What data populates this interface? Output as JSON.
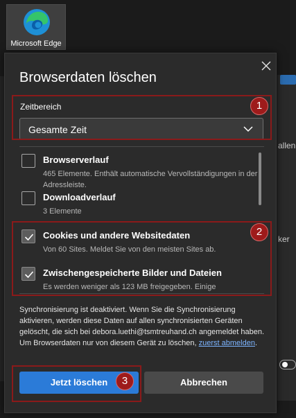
{
  "desktop": {
    "icon_label": "Microsoft Edge",
    "icon": "edge-logo-icon"
  },
  "background": {
    "right_text_1": "allen",
    "right_text_2": "ker"
  },
  "dialog": {
    "title": "Browserdaten löschen",
    "close_icon": "close-icon",
    "time_range": {
      "label": "Zeitbereich",
      "value": "Gesamte Zeit"
    },
    "items": [
      {
        "name": "Browserverlauf",
        "desc": "465 Elemente. Enthält automatische Vervollständigungen in der Adressleiste.",
        "checked": false
      },
      {
        "name": "Downloadverlauf",
        "desc": "3 Elemente",
        "checked": false
      },
      {
        "name": "Cookies und andere Websitedaten",
        "desc": "Von 60 Sites. Meldet Sie von den meisten Sites ab.",
        "checked": true
      },
      {
        "name": "Zwischengespeicherte Bilder und Dateien",
        "desc": "Es werden weniger als 123 MB freigegeben. Einige",
        "checked": true
      }
    ],
    "sync_text": "Synchronisierung ist deaktiviert. Wenn Sie die Synchronisierung aktivieren, werden diese Daten auf allen synchronisierten Geräten gelöscht, die sich bei debora.luethi@tsmtreuhand.ch angemeldet haben. Um Browserdaten nur von diesem Gerät zu löschen,",
    "sync_link": "zuerst abmelden",
    "sync_end": ".",
    "buttons": {
      "primary": "Jetzt löschen",
      "secondary": "Abbrechen"
    }
  },
  "annotations": [
    "1",
    "2",
    "3"
  ],
  "colors": {
    "accent": "#2b7bd8",
    "annotation": "#9e1b1b",
    "dialog_bg": "#2b2b2b"
  }
}
